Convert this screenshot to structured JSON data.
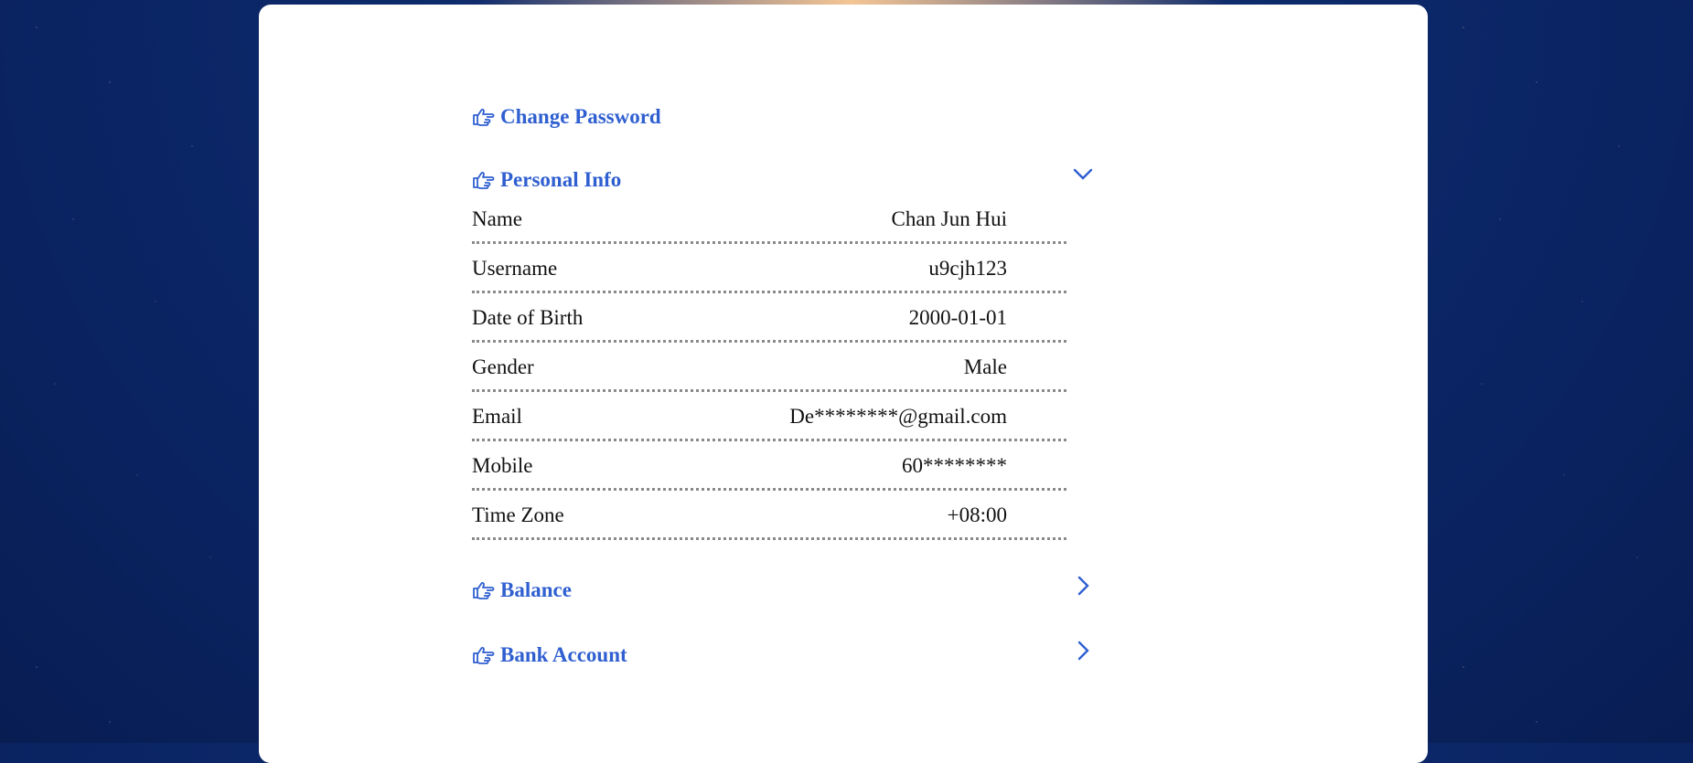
{
  "sections": {
    "change_password": {
      "title": "Change Password"
    },
    "personal_info": {
      "title": "Personal Info",
      "rows": [
        {
          "label": "Name",
          "value": "Chan Jun Hui"
        },
        {
          "label": "Username",
          "value": "u9cjh123"
        },
        {
          "label": "Date of Birth",
          "value": "2000-01-01"
        },
        {
          "label": "Gender",
          "value": "Male"
        },
        {
          "label": "Email",
          "value": "De********@gmail.com"
        },
        {
          "label": "Mobile",
          "value": "60********"
        },
        {
          "label": "Time Zone",
          "value": "+08:00"
        }
      ]
    },
    "balance": {
      "title": "Balance"
    },
    "bank_account": {
      "title": "Bank Account"
    }
  },
  "colors": {
    "accent": "#2f5fd0",
    "background": "#0d2a6b",
    "card": "#ffffff"
  },
  "icons": {
    "section": "pointing-hand-icon",
    "expanded": "chevron-down-icon",
    "collapsed": "chevron-right-icon"
  }
}
